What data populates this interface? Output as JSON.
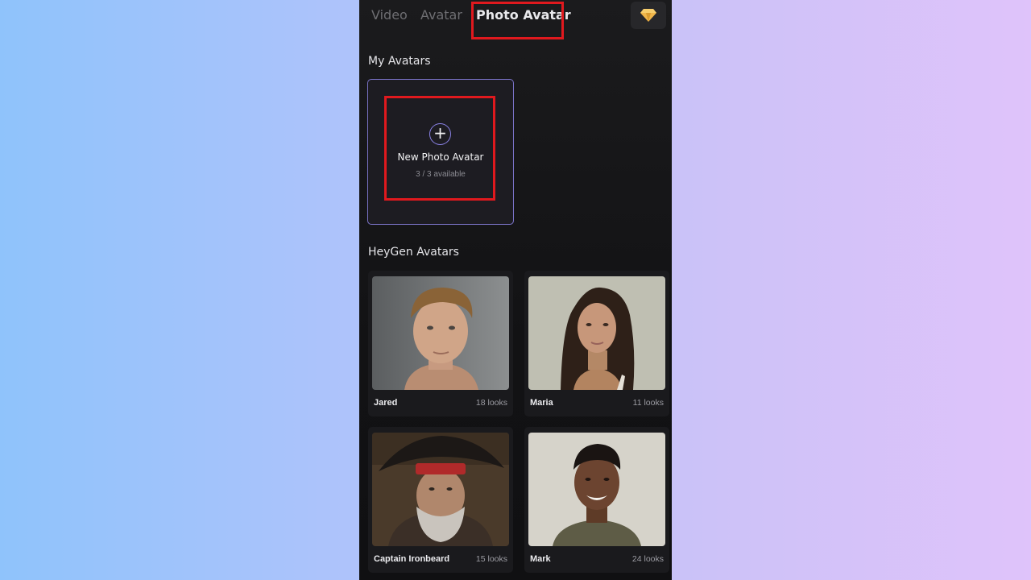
{
  "tabs": [
    {
      "label": "Video"
    },
    {
      "label": "Avatar"
    },
    {
      "label": "Photo Avatar",
      "active": true
    }
  ],
  "premium_icon": "diamond-icon",
  "my_avatars": {
    "title": "My Avatars",
    "new_card": {
      "icon": "plus-icon",
      "title": "New Photo Avatar",
      "subtitle": "3 / 3 available"
    }
  },
  "heygen_avatars": {
    "title": "HeyGen Avatars",
    "items": [
      {
        "name": "Jared",
        "looks": "18 looks"
      },
      {
        "name": "Maria",
        "looks": "11 looks"
      },
      {
        "name": "Captain Ironbeard",
        "looks": "15 looks"
      },
      {
        "name": "Mark",
        "looks": "24 looks"
      }
    ]
  },
  "colors": {
    "accent": "#8a82e6",
    "highlight": "#e0191e",
    "background": "#121214",
    "gem": "#f0b54a"
  }
}
